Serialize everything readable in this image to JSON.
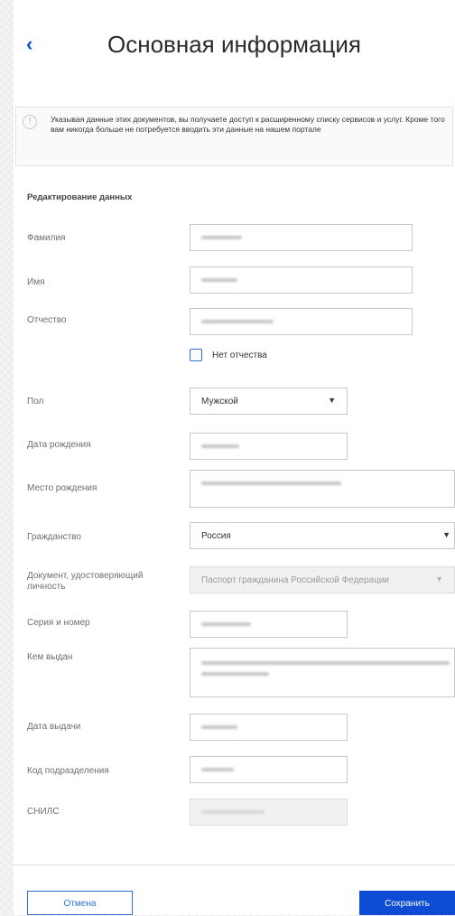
{
  "header": {
    "back_icon": "chevron-left-icon",
    "back_glyph": "‹",
    "title": "Основная информация"
  },
  "info": {
    "icon": "info-icon",
    "icon_glyph": "!",
    "text": "Указывая данные этих документов, вы получаете доступ к расширенному списку сервисов и услуг. Кроме того вам никогда больше не потребуется вводить эти данные на нашем портале"
  },
  "form": {
    "section_title": "Редактирование данных",
    "surname_label": "Фамилия",
    "name_label": "Имя",
    "patronymic_label": "Отчество",
    "no_patronymic_label": "Нет отчества",
    "no_patronymic_checked": false,
    "gender_label": "Пол",
    "gender_value": "Мужской",
    "birthdate_label": "Дата рождения",
    "birthplace_label": "Место рождения",
    "citizenship_label": "Гражданство",
    "citizenship_value": "Россия",
    "document_label": "Документ, удостоверяющий личность",
    "document_value": "Паспорт гражданина Российской Федерации",
    "series_label": "Серия и номер",
    "issued_by_label": "Кем выдан",
    "issue_date_label": "Дата выдачи",
    "division_code_label": "Код подразделения",
    "snils_label": "СНИЛС",
    "dropdown_glyph": "▼"
  },
  "actions": {
    "cancel_label": "Отмена",
    "save_label": "Сохранить"
  },
  "colors": {
    "primary": "#0d4cd3",
    "checkbox_border": "#2d6fd8"
  }
}
